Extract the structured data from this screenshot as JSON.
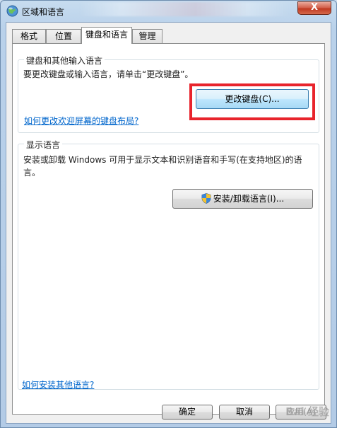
{
  "window": {
    "title": "区域和语言",
    "close_label": "X"
  },
  "tabs": [
    {
      "label": "格式"
    },
    {
      "label": "位置"
    },
    {
      "label": "键盘和语言",
      "active": true
    },
    {
      "label": "管理"
    }
  ],
  "keyboard_group": {
    "title": "键盘和其他输入语言",
    "description": "要更改键盘或输入语言，请单击“更改键盘”。",
    "change_keyboard_button": "更改键盘(C)...",
    "welcome_link": "如何更改欢迎屏幕的键盘布局?"
  },
  "display_group": {
    "title": "显示语言",
    "description": "安装或卸载 Windows 可用于显示文本和识别语音和手写(在支持地区)的语言。",
    "install_button": "安装/卸载语言(I)..."
  },
  "bottom_link": "如何安装其他语言?",
  "buttons": {
    "ok": "确定",
    "cancel": "取消",
    "apply": "应用(A)"
  },
  "watermark": "Bai 经验",
  "colors": {
    "highlight": "#e8242c",
    "link": "#0066cc"
  }
}
